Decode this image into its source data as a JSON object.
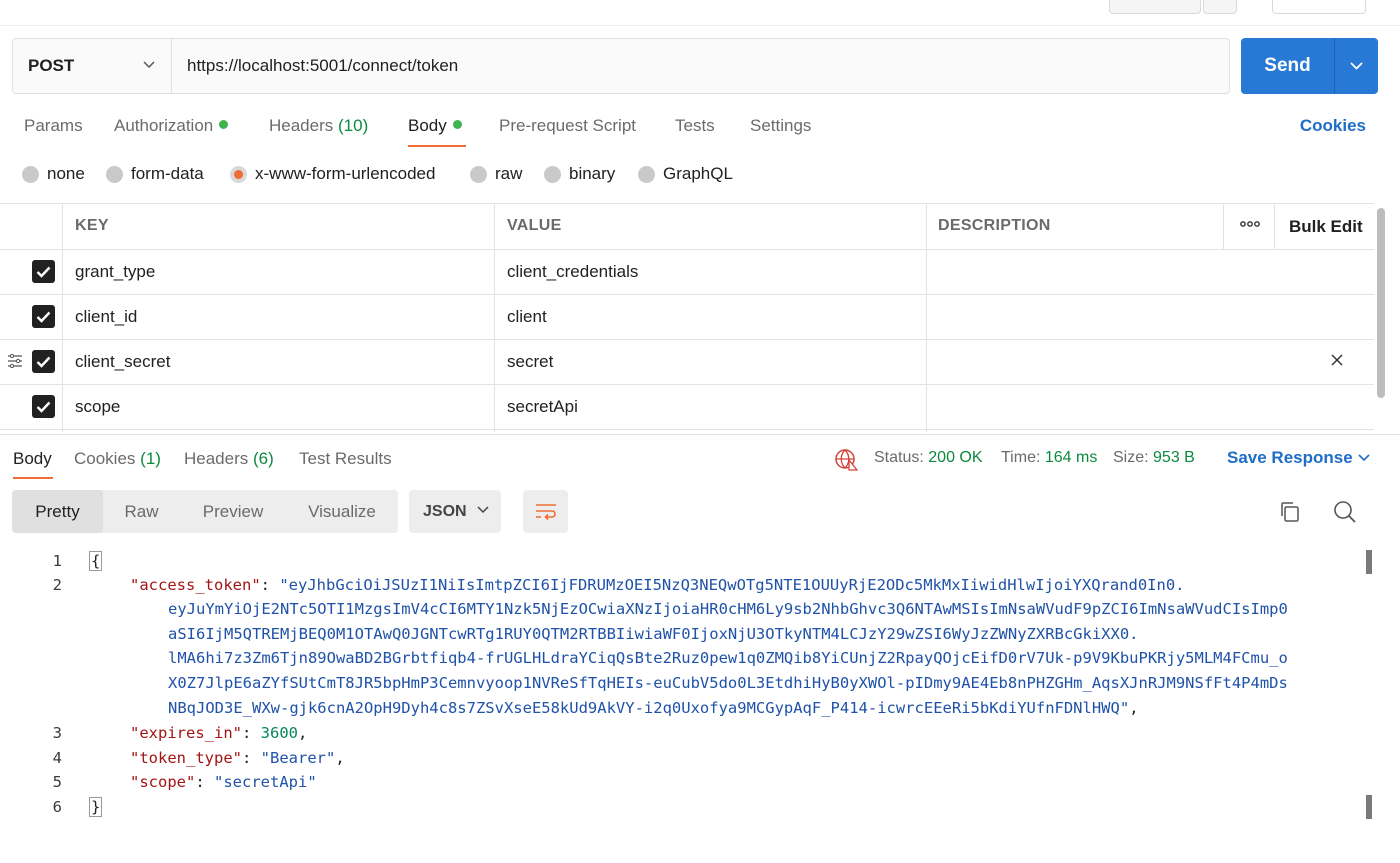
{
  "request": {
    "method": "POST",
    "url": "https://localhost:5001/connect/token",
    "send_label": "Send"
  },
  "request_tabs": {
    "params": "Params",
    "authorization": "Authorization",
    "headers": "Headers",
    "headers_count": "(10)",
    "body": "Body",
    "prerequest": "Pre-request Script",
    "tests": "Tests",
    "settings": "Settings",
    "cookies": "Cookies"
  },
  "body_types": [
    "none",
    "form-data",
    "x-www-form-urlencoded",
    "raw",
    "binary",
    "GraphQL"
  ],
  "body_type_selected": "x-www-form-urlencoded",
  "kv_table": {
    "headers": {
      "key": "KEY",
      "value": "VALUE",
      "description": "DESCRIPTION",
      "bulk_edit": "Bulk Edit"
    },
    "rows": [
      {
        "key": "grant_type",
        "value": "client_credentials",
        "checked": true
      },
      {
        "key": "client_id",
        "value": "client",
        "checked": true
      },
      {
        "key": "client_secret",
        "value": "secret",
        "checked": true
      },
      {
        "key": "scope",
        "value": "secretApi",
        "checked": true
      }
    ]
  },
  "response": {
    "tabs": {
      "body": "Body",
      "cookies": "Cookies",
      "cookies_count": "(1)",
      "headers": "Headers",
      "headers_count": "(6)",
      "test_results": "Test Results"
    },
    "status_label": "Status:",
    "status_value": "200 OK",
    "time_label": "Time:",
    "time_value": "164 ms",
    "size_label": "Size:",
    "size_value": "953 B",
    "save_response": "Save Response",
    "views": [
      "Pretty",
      "Raw",
      "Preview",
      "Visualize"
    ],
    "active_view": "Pretty",
    "format": "JSON",
    "line_numbers": [
      "1",
      "2",
      "3",
      "4",
      "5",
      "6"
    ],
    "json": {
      "open": "{",
      "close": "}",
      "access_token_key": "\"access_token\"",
      "access_token_lines": [
        "\"eyJhbGciOiJSUzI1NiIsImtpZCI6IjFDRUMzOEI5NzQ3NEQwOTg5NTE1OUUyRjE2ODc5MkMxIiwidHlwIjoiYXQrand0In0.",
        "eyJuYmYiOjE2NTc5OTI1MzgsImV4cCI6MTY1Nzk5NjEzOCwiaXNzIjoiaHR0cHM6Ly9sb2NhbGhvc3Q6NTAwMSIsImNsaWVudF9pZCI6ImNsaWVudCIsImp0",
        "aSI6IjM5QTREMjBEQ0M1OTAwQ0JGNTcwRTg1RUY0QTM2RTBBIiwiaWF0IjoxNjU3OTkyNTM4LCJzY29wZSI6WyJzZWNyZXRBcGkiXX0.",
        "lMA6hi7z3Zm6Tjn89OwaBD2BGrbtfiqb4-frUGLHLdraYCiqQsBte2Ruz0pew1q0ZMQib8YiCUnjZ2RpayQOjcEifD0rV7Uk-p9V9KbuPKRjy5MLM4FCmu_o",
        "X0Z7JlpE6aZYfSUtCmT8JR5bpHmP3Cemnvyoop1NVReSfTqHEIs-euCubV5do0L3EtdhiHyB0yXWOl-pIDmy9AE4Eb8nPHZGHm_AqsXJnRJM9NSfFt4P4mDs",
        "NBqJOD3E_WXw-gjk6cnA2OpH9Dyh4c8s7ZSvXseE58kUd9AkVY-i2q0Uxofya9MCGypAqF_P414-icwrcEEeRi5bKdiYUfnFDNlHWQ\""
      ],
      "expires_in_key": "\"expires_in\"",
      "expires_in_value": "3600",
      "token_type_key": "\"token_type\"",
      "token_type_value": "\"Bearer\"",
      "scope_key": "\"scope\"",
      "scope_value": "\"secretApi\""
    }
  },
  "colors": {
    "send": "#2878d6",
    "accent": "#ef6c35",
    "link": "#1f6dc6",
    "ok": "#0c8a3e",
    "dot": "#3fb34f"
  }
}
